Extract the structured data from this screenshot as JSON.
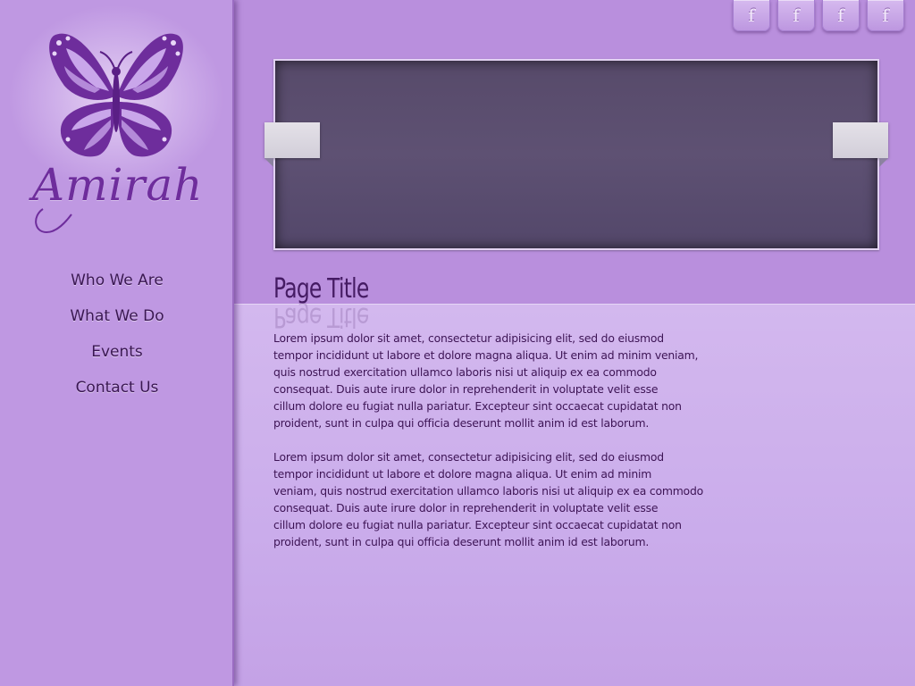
{
  "brand": {
    "name": "Amirah",
    "logo_icon": "butterfly-icon"
  },
  "nav": {
    "items": [
      {
        "label": "Who We Are"
      },
      {
        "label": "What We Do"
      },
      {
        "label": "Events"
      },
      {
        "label": "Contact Us"
      }
    ]
  },
  "social": {
    "buttons": [
      {
        "glyph": "f",
        "icon": "facebook-icon"
      },
      {
        "glyph": "f",
        "icon": "facebook-icon"
      },
      {
        "glyph": "f",
        "icon": "facebook-icon"
      },
      {
        "glyph": "f",
        "icon": "facebook-icon"
      }
    ]
  },
  "main": {
    "title": "Page Title",
    "paragraphs": [
      "Lorem ipsum dolor sit amet, consectetur adipisicing elit, sed do eiusmod\ntempor incididunt ut labore et dolore magna aliqua. Ut enim ad minim veniam,\nquis nostrud exercitation ullamco laboris nisi ut aliquip ex ea commodo\nconsequat. Duis aute irure dolor in reprehenderit in voluptate velit esse\ncillum dolore eu fugiat nulla pariatur. Excepteur sint occaecat cupidatat non\nproident, sunt in culpa qui officia deserunt mollit anim id est laborum.",
      "Lorem ipsum dolor sit amet, consectetur adipisicing elit, sed do eiusmod\ntempor incididunt ut labore et dolore magna aliqua. Ut enim ad minim\nveniam, quis nostrud exercitation ullamco laboris nisi ut aliquip ex ea commodo\nconsequat. Duis aute irure dolor in reprehenderit in voluptate velit esse\ncillum dolore eu fugiat nulla pariatur. Excepteur sint occaecat cupidatat non\nproident, sunt in culpa qui officia deserunt mollit anim id est laborum."
    ]
  },
  "colors": {
    "background": "#b98fdd",
    "sidebar": "#c49fe4",
    "accent_purple": "#6e2d9c",
    "text_dark": "#3d1455",
    "slider_bg": "#574a6a"
  }
}
